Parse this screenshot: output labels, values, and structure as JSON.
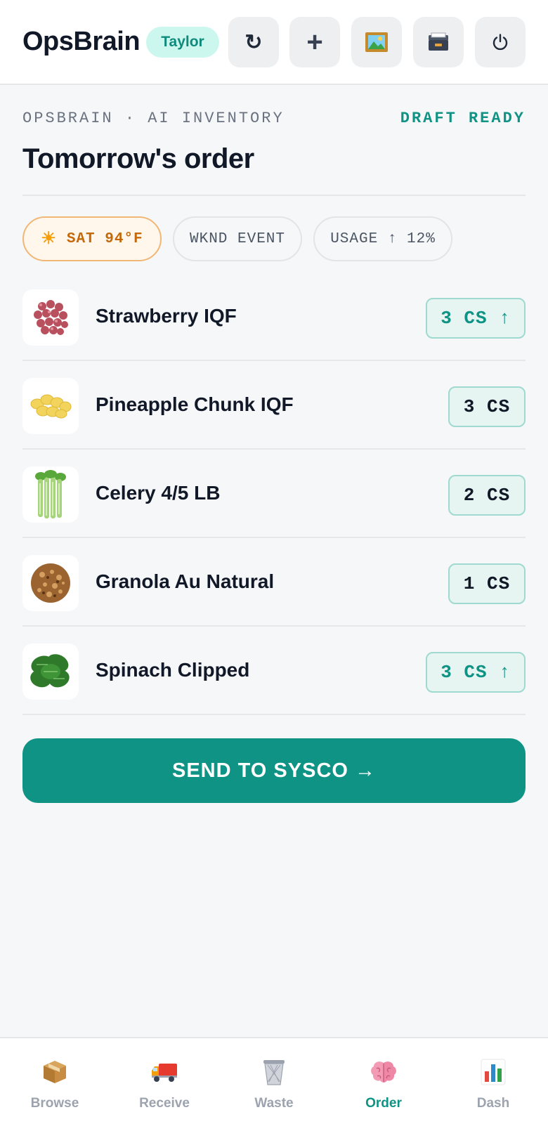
{
  "header": {
    "brand": "OpsBrain",
    "user": "Taylor",
    "buttons": [
      {
        "name": "refresh-button",
        "icon": "refresh-icon",
        "glyph": "↻"
      },
      {
        "name": "add-button",
        "icon": "plus-icon",
        "glyph": "+"
      },
      {
        "name": "gallery-button",
        "icon": "framed-picture-icon",
        "glyph": ""
      },
      {
        "name": "archive-button",
        "icon": "card-file-box-icon",
        "glyph": ""
      },
      {
        "name": "power-button",
        "icon": "power-icon",
        "glyph": ""
      }
    ]
  },
  "section": {
    "eyebrow": "OPSBRAIN · AI INVENTORY",
    "status": "DRAFT READY",
    "title": "Tomorrow's order"
  },
  "chips": [
    {
      "label": "SAT 94°F",
      "icon": "sun-icon",
      "glyph": "☀"
    },
    {
      "label": "WKND EVENT"
    },
    {
      "label": "USAGE ↑ 12%"
    }
  ],
  "items": [
    {
      "name": "Strawberry IQF",
      "qty": "3 CS ↑",
      "trend": "up",
      "thumb": "strawberry-icon"
    },
    {
      "name": "Pineapple Chunk IQF",
      "qty": "3 CS",
      "trend": "flat",
      "thumb": "pineapple-chunk-icon"
    },
    {
      "name": "Celery 4/5 LB",
      "qty": "2 CS",
      "trend": "flat",
      "thumb": "celery-icon"
    },
    {
      "name": "Granola Au Natural",
      "qty": "1 CS",
      "trend": "flat",
      "thumb": "granola-icon"
    },
    {
      "name": "Spinach Clipped",
      "qty": "3 CS ↑",
      "trend": "up",
      "thumb": "spinach-icon"
    }
  ],
  "cta": {
    "label": "SEND TO SYSCO →"
  },
  "nav": [
    {
      "label": "Browse",
      "icon": "package-icon",
      "active": false
    },
    {
      "label": "Receive",
      "icon": "delivery-truck-icon",
      "active": false
    },
    {
      "label": "Waste",
      "icon": "wastebasket-icon",
      "active": false
    },
    {
      "label": "Order",
      "icon": "brain-icon",
      "active": true
    },
    {
      "label": "Dash",
      "icon": "bar-chart-icon",
      "active": false
    }
  ],
  "colors": {
    "accent": "#0f9384",
    "warm": "#c4690a",
    "background": "#f6f7f9"
  }
}
